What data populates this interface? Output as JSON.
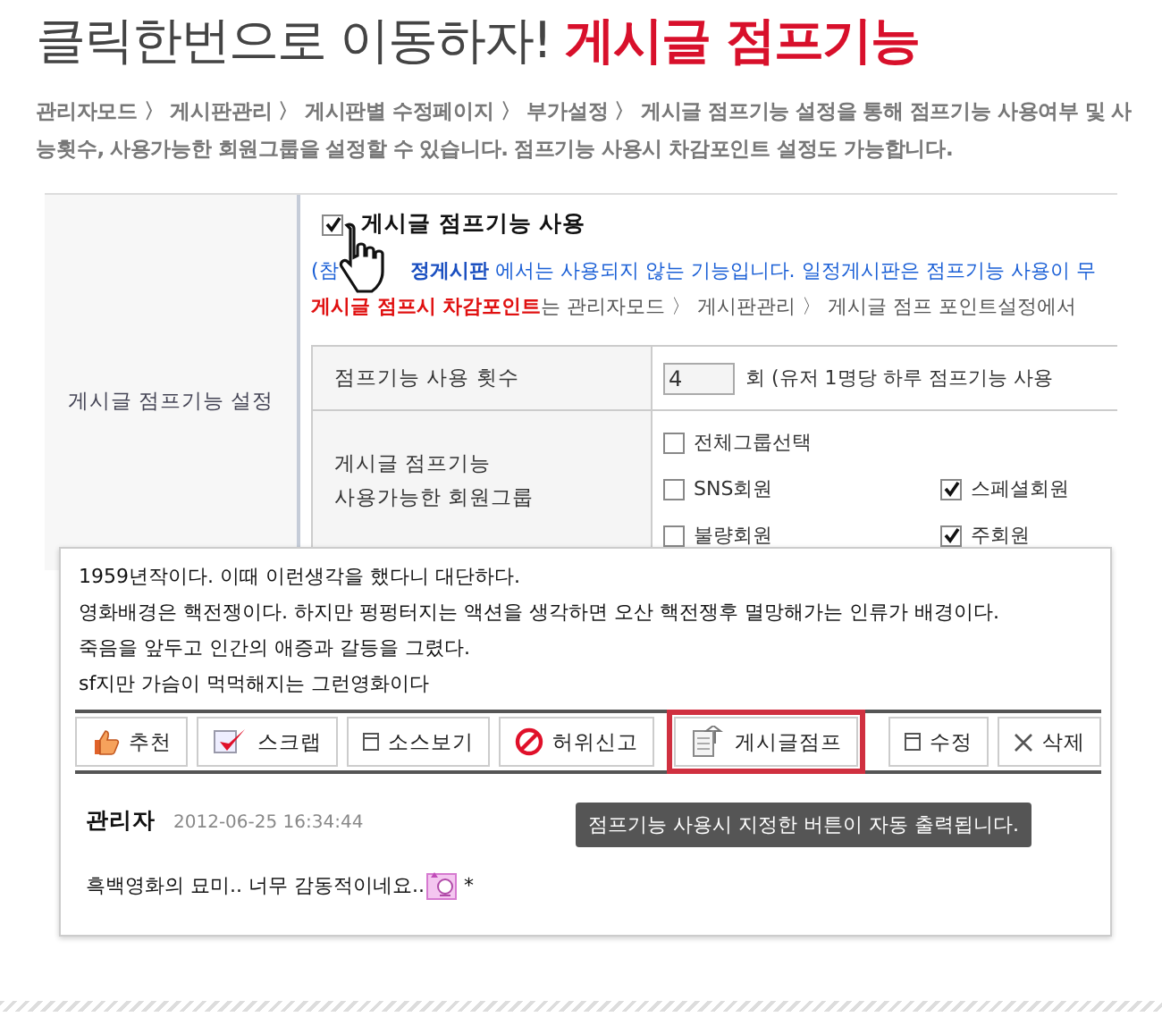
{
  "header": {
    "title": "클릭한번으로 이동하자!",
    "title_emphasis": "게시글 점프기능"
  },
  "description": "관리자모드 〉 게시판관리 〉 게시판별 수정페이지 〉 부가설정 〉 게시글 점프기능 설정을 통해 점프기능 사용여부 및 사능횟수, 사용가능한 회원그룹을 설정할 수 있습니다. 점프기능 사용시 차감포인트 설정도 가능합니다.",
  "settings": {
    "label": "게시글 점프기능 설정",
    "enable": {
      "label": "게시글 점프기능 사용",
      "checked": true
    },
    "note_start": "(참",
    "note": "**정게시판** 에서는 사용되지 않는 기능입니다. 일정게시판은 점프기능 사용이 무",
    "point_note": "**게시글 점프시 차감포인트**는 관리자모드 〉 게시판관리 〉 게시글 점프 포인트설정에서",
    "count": {
      "label": "점프기능 사용 횟수",
      "value": "4",
      "suffix": "회 (유저 1명당 하루 점프기능 사용"
    },
    "groups": {
      "label_lines": [
        "게시글 점프기능",
        "사용가능한 회원그룹"
      ],
      "items": [
        {
          "label": "전체그룹선택",
          "checked": false
        },
        {
          "label": "SNS회원",
          "checked": false
        },
        {
          "label": "스페셜회원",
          "checked": true
        },
        {
          "label": "불량회원",
          "checked": false
        },
        {
          "label": "주회원",
          "checked": true
        }
      ]
    }
  },
  "comment": {
    "lines": [
      "1959년작이다. 이때 이런생각을 했다니 대단하다.",
      "영화배경은 핵전쟁이다. 하지만 펑펑터지는 액션을 생각하면 오산 핵전쟁후 멸망해가는 인류가 배경이다.",
      "죽음을 앞두고 인간의 애증과 갈등을 그렸다.",
      "sf지만 가슴이 먹먹해지는 그런영화이다"
    ],
    "buttons_left": [
      {
        "label": "추천",
        "kind": "thumb",
        "highlighted": false
      },
      {
        "label": "스크랩",
        "kind": "check",
        "highlighted": false
      },
      {
        "label": "소스보기",
        "kind": "doc",
        "highlighted": false
      },
      {
        "label": "허위신고",
        "kind": "ban",
        "highlighted": false
      },
      {
        "label": "게시글점프",
        "kind": "jump",
        "highlighted": true
      }
    ],
    "buttons_right": [
      {
        "label": "수정",
        "kind": "doc",
        "highlighted": false
      },
      {
        "label": "삭제",
        "kind": "x",
        "highlighted": false
      }
    ],
    "tooltip": "점프기능 사용시 지정한 버튼이 자동 출력됩니다.",
    "author": "관리자",
    "date": "2012-06-25 16:34:44",
    "reply": "흑백영화의 묘미.. 너무 감동적이네요..",
    "reply_suffix": "*"
  }
}
